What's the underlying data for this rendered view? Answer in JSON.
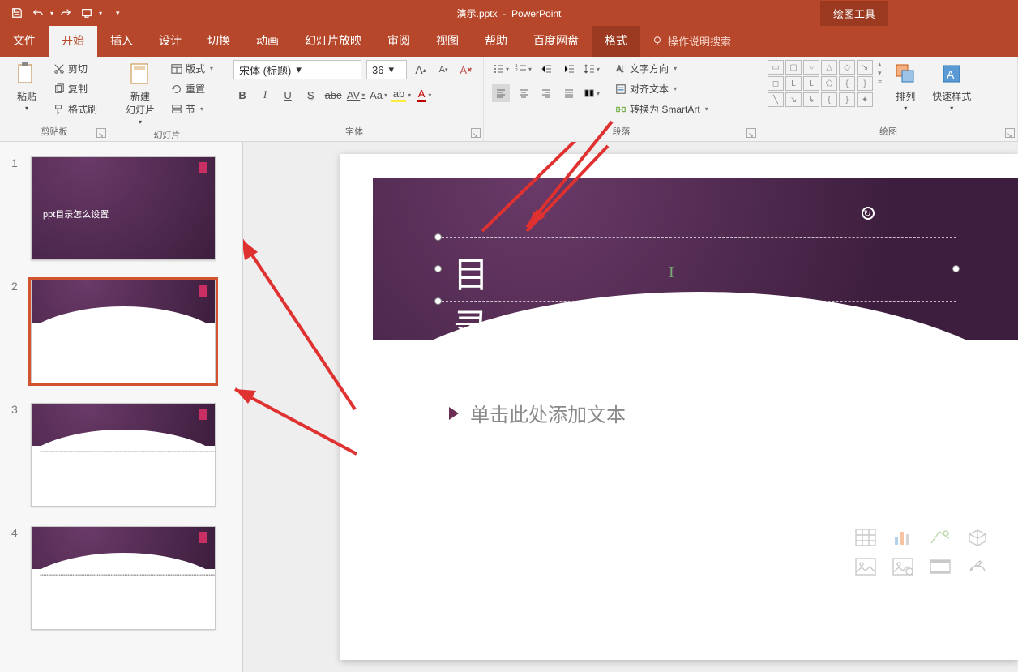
{
  "app": {
    "doc_title": "演示.pptx",
    "app_name": "PowerPoint",
    "context_tab": "绘图工具"
  },
  "qat": {
    "save": "保存",
    "undo": "撤销",
    "redo": "恢复",
    "start_slideshow": "从头开始"
  },
  "tabs": {
    "file": "文件",
    "home": "开始",
    "insert": "插入",
    "design": "设计",
    "transitions": "切换",
    "animations": "动画",
    "slideshow": "幻灯片放映",
    "review": "审阅",
    "view": "视图",
    "help": "帮助",
    "baidu": "百度网盘",
    "format": "格式",
    "tellme": "操作说明搜索"
  },
  "ribbon": {
    "clipboard": {
      "label": "剪贴板",
      "paste": "粘贴",
      "cut": "剪切",
      "copy": "复制",
      "format_painter": "格式刷"
    },
    "slides": {
      "label": "幻灯片",
      "new_slide": "新建\n幻灯片",
      "layout": "版式",
      "reset": "重置",
      "section": "节"
    },
    "font": {
      "label": "字体",
      "font_name": "宋体 (标题)",
      "font_size": "36",
      "bold": "B",
      "italic": "I",
      "underline": "U",
      "strike": "S",
      "shadow": "S",
      "char_spacing": "AV",
      "change_case": "Aa",
      "clear": "A",
      "grow": "A",
      "shrink": "A"
    },
    "paragraph": {
      "label": "段落",
      "text_direction": "文字方向",
      "align_text": "对齐文本",
      "smartart": "转换为 SmartArt"
    },
    "drawing": {
      "label": "绘图",
      "arrange": "排列",
      "quick_styles": "快速样式"
    }
  },
  "thumbnails": {
    "items": [
      {
        "n": "1",
        "title": "ppt目录怎么设置"
      },
      {
        "n": "2",
        "title": ""
      },
      {
        "n": "3",
        "title": ""
      },
      {
        "n": "4",
        "title": ""
      }
    ]
  },
  "slide": {
    "title_text": "目录",
    "content_placeholder": "单击此处添加文本"
  }
}
